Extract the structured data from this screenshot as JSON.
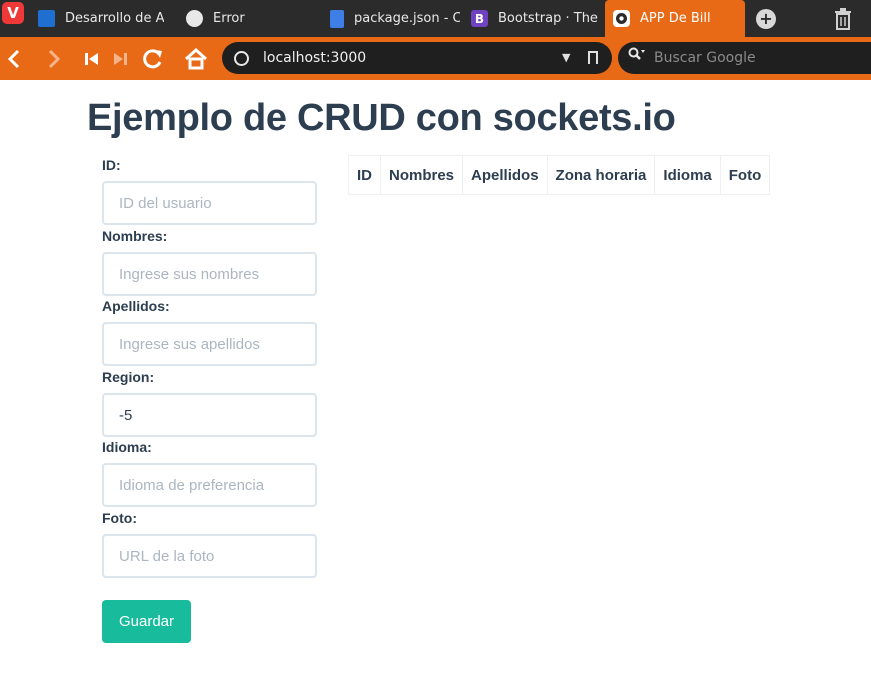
{
  "browser": {
    "tabs": [
      {
        "title": "Desarrollo de A",
        "icon": "user-icon"
      },
      {
        "title": "Error",
        "icon": "globe-icon"
      },
      {
        "title": "package.json - C",
        "icon": "document-icon"
      },
      {
        "title": "Bootstrap · The",
        "icon": "bootstrap-icon"
      },
      {
        "title": "APP De Bill",
        "icon": "app-icon",
        "active": true
      }
    ],
    "logo_letter": "V",
    "new_tab_symbol": "+",
    "url": "localhost:3000",
    "search_placeholder": "Buscar Google",
    "accent_color": "#e86a17"
  },
  "page": {
    "title": "Ejemplo de CRUD con sockets.io",
    "form": {
      "fields": [
        {
          "label": "ID:",
          "placeholder": "ID del usuario",
          "value": ""
        },
        {
          "label": "Nombres:",
          "placeholder": "Ingrese sus nombres",
          "value": ""
        },
        {
          "label": "Apellidos:",
          "placeholder": "Ingrese sus apellidos",
          "value": ""
        },
        {
          "label": "Region:",
          "placeholder": "",
          "value": "-5"
        },
        {
          "label": "Idioma:",
          "placeholder": "Idioma de preferencia",
          "value": ""
        },
        {
          "label": "Foto:",
          "placeholder": "URL de la foto",
          "value": ""
        }
      ],
      "save_label": "Guardar",
      "save_color": "#18bc9c"
    },
    "table": {
      "headers": [
        "ID",
        "Nombres",
        "Apellidos",
        "Zona horaria",
        "Idioma",
        "Foto"
      ]
    }
  }
}
